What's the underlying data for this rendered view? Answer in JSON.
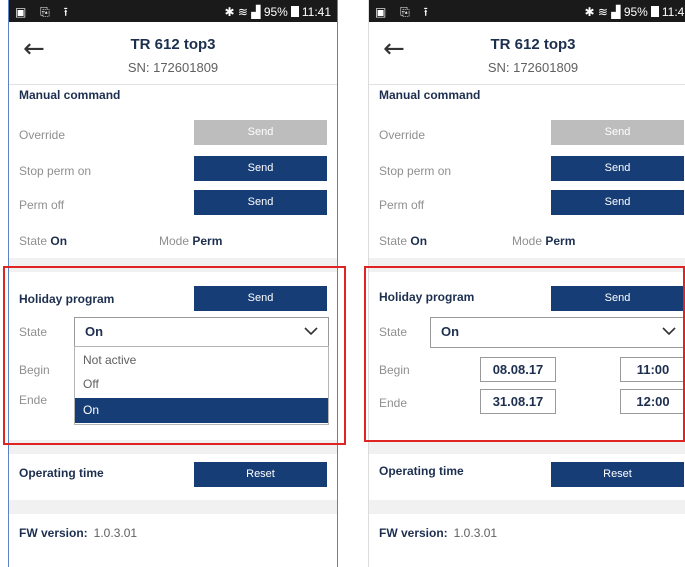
{
  "status_bar": {
    "left_icons": [
      "gallery-icon",
      "clipboard-icon",
      "upload-icon"
    ],
    "right_icons": [
      "bluetooth-icon",
      "nfc-icon",
      "wifi-icon",
      "signal-icon"
    ],
    "battery": "95%",
    "time": "11:41"
  },
  "header": {
    "back_icon": "arrow-left-icon",
    "title": "TR 612 top3",
    "serial": "SN: 172601809"
  },
  "manual": {
    "title": "Manual command",
    "rows": [
      {
        "label": "Override",
        "button": "Send",
        "enabled": false
      },
      {
        "label": "Stop perm on",
        "button": "Send",
        "enabled": true
      },
      {
        "label": "Perm off",
        "button": "Send",
        "enabled": true
      }
    ],
    "state_label": "State",
    "state_value": "On",
    "mode_label": "Mode",
    "mode_value": "Perm"
  },
  "holiday": {
    "title": "Holiday program",
    "send": "Send",
    "state_label": "State",
    "state_value": "On",
    "begin_label": "Begin",
    "end_label": "Ende",
    "begin_date": "08.08.17",
    "begin_time": "11:00",
    "end_date": "31.08.17",
    "end_time": "12:00",
    "options": [
      "Not active",
      "Off",
      "On"
    ],
    "selected_option": "On"
  },
  "operating": {
    "title": "Operating time",
    "button": "Reset"
  },
  "fw": {
    "label": "FW version:",
    "value": "1.0.3.01"
  },
  "colors": {
    "button": "#173d77",
    "button_disabled": "#bdbdbd",
    "highlight": "#e02424",
    "title_text": "#1d2f4f"
  }
}
